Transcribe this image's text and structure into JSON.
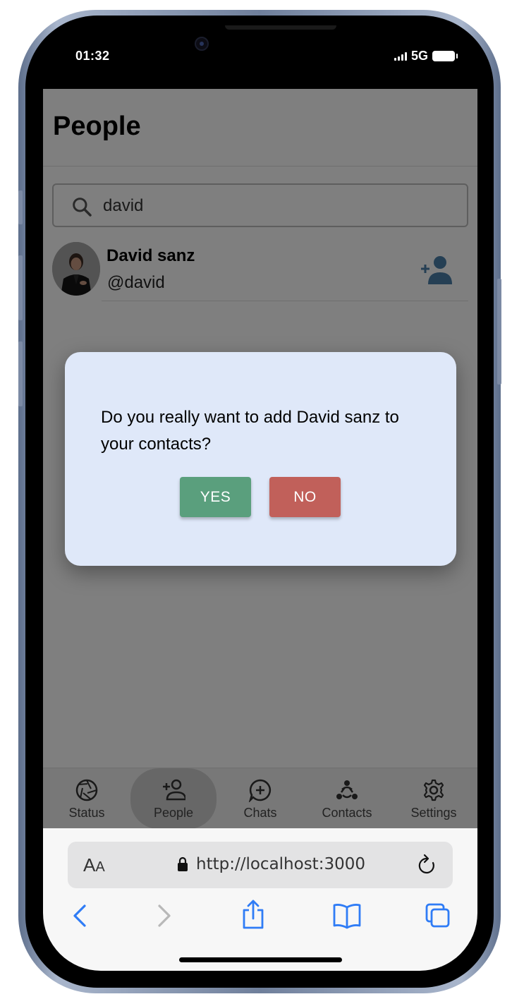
{
  "status_bar": {
    "time": "01:32",
    "network": "5G"
  },
  "app": {
    "title": "People",
    "search": {
      "value": "david"
    },
    "results": [
      {
        "name": "David sanz",
        "handle": "@david"
      }
    ],
    "tabs": [
      {
        "label": "Status",
        "icon": "shutter-icon",
        "active": false
      },
      {
        "label": "People",
        "icon": "person-add-icon",
        "active": true
      },
      {
        "label": "Chats",
        "icon": "chat-plus-icon",
        "active": false
      },
      {
        "label": "Contacts",
        "icon": "contacts-group-icon",
        "active": false
      },
      {
        "label": "Settings",
        "icon": "gear-icon",
        "active": false
      }
    ]
  },
  "dialog": {
    "message": "Do you really want to add David sanz to your contacts?",
    "yes_label": "YES",
    "no_label": "NO"
  },
  "browser": {
    "text_size_label_large": "A",
    "text_size_label_small": "A",
    "url": "http://localhost:3000"
  },
  "colors": {
    "accent": "#4a7fa8",
    "yes_button": "#5a9f7d",
    "no_button": "#c1605a",
    "dialog_background": "#dfe8f9",
    "ios_blue": "#2f7cf6"
  }
}
